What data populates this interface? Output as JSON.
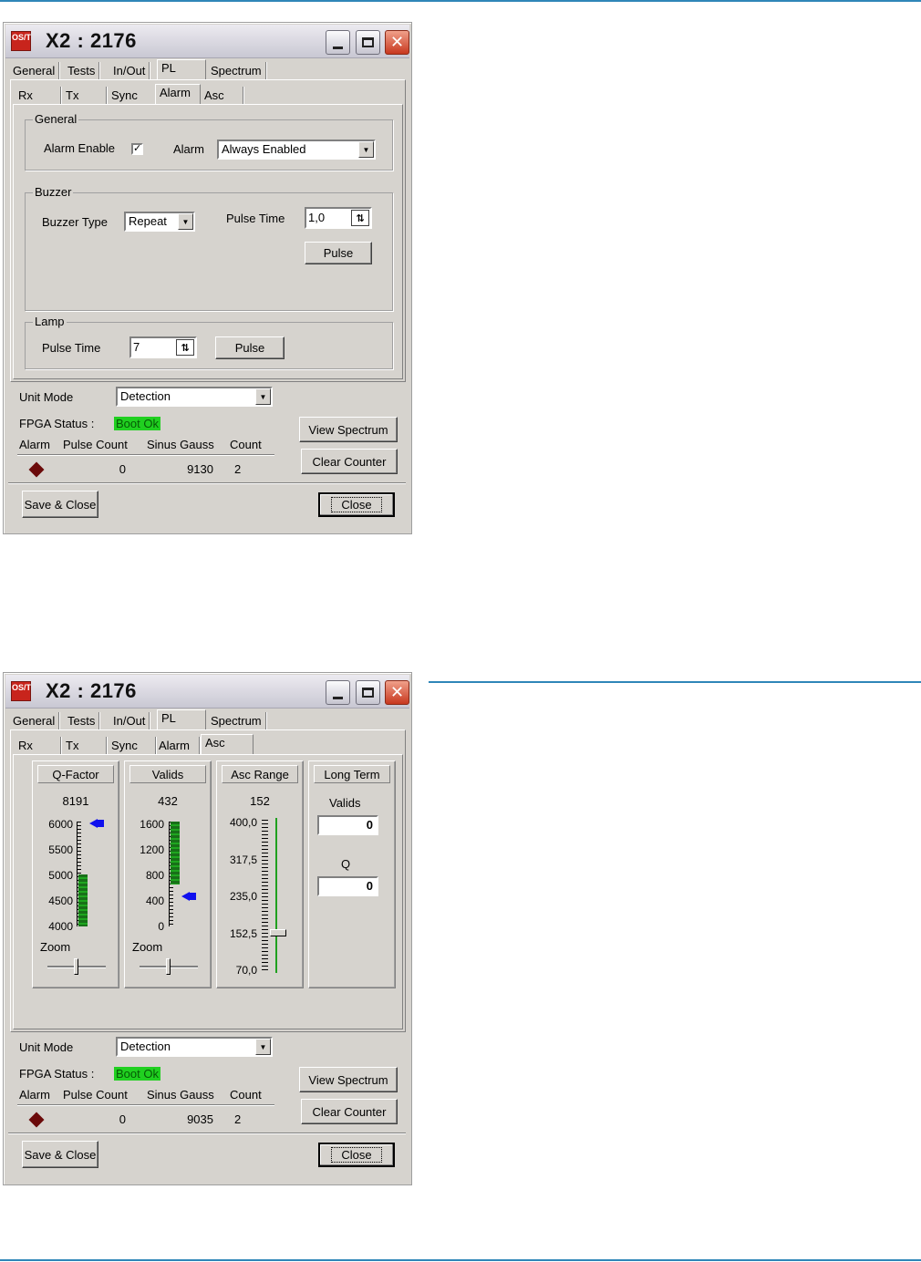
{
  "windows": [
    {
      "title": "X2 : 2176",
      "app_icon_text": "OS/T",
      "main_tabs": [
        "General",
        "Tests",
        "In/Out",
        "PL",
        "Spectrum"
      ],
      "main_tab_selected": "PL",
      "sub_tabs": [
        "Rx",
        "Tx",
        "Sync",
        "Alarm",
        "Asc"
      ],
      "sub_tab_selected": "Alarm",
      "general_group": {
        "label": "General",
        "alarm_enable_label": "Alarm Enable",
        "alarm_enable_checked": true,
        "alarm_label": "Alarm",
        "alarm_value": "Always Enabled"
      },
      "buzzer_group": {
        "label": "Buzzer",
        "type_label": "Buzzer Type",
        "type_value": "Repeat",
        "pulse_time_label": "Pulse Time",
        "pulse_time_value": "1,0",
        "pulse_button": "Pulse"
      },
      "lamp_group": {
        "label": "Lamp",
        "pulse_time_label": "Pulse Time",
        "pulse_time_value": "7",
        "pulse_button": "Pulse"
      },
      "status": {
        "unit_mode_label": "Unit Mode",
        "unit_mode_value": "Detection",
        "fpga_label": "FPGA Status :",
        "fpga_value": "Boot Ok",
        "fpga_color": "#20d020",
        "view_spectrum": "View Spectrum",
        "clear_counter": "Clear Counter",
        "headers": [
          "Alarm",
          "Pulse Count",
          "Sinus Gauss",
          "Count"
        ],
        "alarm_indicator_color": "#6b0a0a",
        "pulse_count": "0",
        "sinus_gauss": "9130",
        "count": "2"
      },
      "footer": {
        "save_close": "Save & Close",
        "close": "Close"
      }
    },
    {
      "title": "X2 : 2176",
      "app_icon_text": "OS/T",
      "main_tabs": [
        "General",
        "Tests",
        "In/Out",
        "PL",
        "Spectrum"
      ],
      "main_tab_selected": "PL",
      "sub_tabs": [
        "Rx",
        "Tx",
        "Sync",
        "Alarm",
        "Asc"
      ],
      "sub_tab_selected": "Asc",
      "gauges": {
        "qfactor": {
          "title": "Q-Factor",
          "value": "8191",
          "ticks": [
            "6000",
            "5500",
            "5000",
            "4500",
            "4000"
          ],
          "zoom_label": "Zoom",
          "bar_level": 5000,
          "pointer_level": 6000
        },
        "valids": {
          "title": "Valids",
          "value": "432",
          "ticks": [
            "1600",
            "1200",
            "800",
            "400",
            "0"
          ],
          "zoom_label": "Zoom",
          "bar_level": 1600,
          "pointer_level": 400
        },
        "asc_range": {
          "title": "Asc Range",
          "value": "152",
          "ticks": [
            "400,0",
            "317,5",
            "235,0",
            "152,5",
            "70,0"
          ]
        },
        "long_term": {
          "title": "Long Term",
          "valids_label": "Valids",
          "valids_value": "0",
          "q_label": "Q",
          "q_value": "0"
        }
      },
      "status": {
        "unit_mode_label": "Unit Mode",
        "unit_mode_value": "Detection",
        "fpga_label": "FPGA Status :",
        "fpga_value": "Boot Ok",
        "fpga_color": "#20d020",
        "view_spectrum": "View Spectrum",
        "clear_counter": "Clear Counter",
        "headers": [
          "Alarm",
          "Pulse Count",
          "Sinus Gauss",
          "Count"
        ],
        "alarm_indicator_color": "#6b0a0a",
        "pulse_count": "0",
        "sinus_gauss": "9035",
        "count": "2"
      },
      "footer": {
        "save_close": "Save & Close",
        "close": "Close"
      }
    }
  ],
  "accent_color": "#2f86b8"
}
